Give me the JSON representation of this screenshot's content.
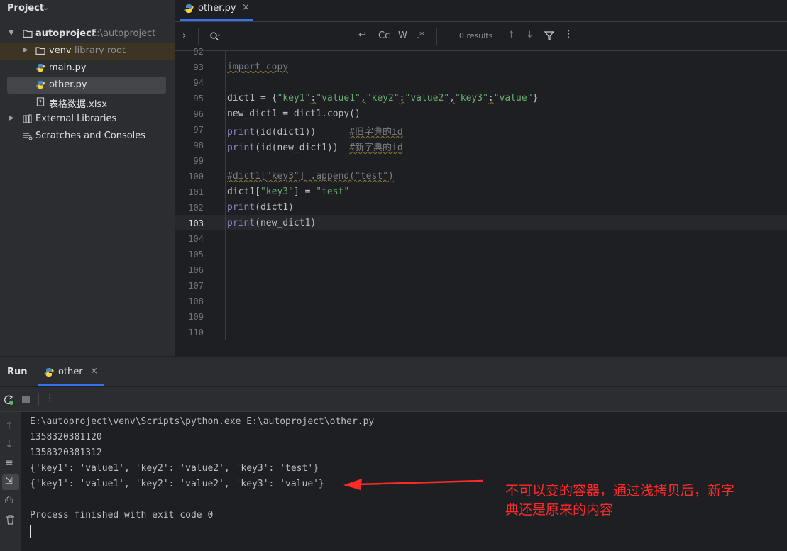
{
  "project_panel": {
    "title": "Project",
    "tree": [
      {
        "name": "autoproject",
        "hint": "E:\\autoproject"
      },
      {
        "name": "venv",
        "hint": "library root"
      },
      {
        "name": "main.py"
      },
      {
        "name": "other.py"
      },
      {
        "name": "表格数据.xlsx"
      },
      {
        "name": "External Libraries"
      },
      {
        "name": "Scratches and Consoles"
      }
    ]
  },
  "editor": {
    "tab_label": "other.py",
    "find": {
      "results": "0 results",
      "cc": "Cc",
      "w": "W",
      "regex": ".*"
    },
    "line_numbers": [
      "92",
      "93",
      "94",
      "95",
      "96",
      "97",
      "98",
      "99",
      "100",
      "101",
      "102",
      "103",
      "104",
      "105",
      "106",
      "107",
      "108",
      "109",
      "110"
    ],
    "code": {
      "l93": "import copy",
      "l95_a": "dict1 = {",
      "l95_k1": "\"key1\"",
      "l95_v1": "\"value1\"",
      "l95_k2": "\"key2\"",
      "l95_v2": "\"value2\"",
      "l95_k3": "\"key3\"",
      "l95_v3": "\"value\"",
      "l96": "new_dict1 = dict1.copy()",
      "l97_fn": "print",
      "l97_rest": "(id(dict1))",
      "l97_cmt": "#旧字典的id",
      "l98_fn": "print",
      "l98_rest": "(id(new_dict1))",
      "l98_cmt": "#新字典的id",
      "l100": "#dict1[\"key3\"] .append(\"test\")",
      "l101_a": "dict1[",
      "l101_s1": "\"key3\"",
      "l101_b": "] = ",
      "l101_s2": "\"test\"",
      "l102_fn": "print",
      "l102_rest": "(dict1)",
      "l103_fn": "print",
      "l103_rest": "(new_dict1)"
    }
  },
  "run_panel": {
    "title": "Run",
    "tab_label": "other",
    "output": [
      "E:\\autoproject\\venv\\Scripts\\python.exe E:\\autoproject\\other.py",
      "1358320381120",
      "1358320381312",
      "{'key1': 'value1', 'key2': 'value2', 'key3': 'test'}",
      "{'key1': 'value1', 'key2': 'value2', 'key3': 'value'}",
      "",
      "Process finished with exit code 0"
    ],
    "annotation": {
      "line1": "不可以变的容器，通过浅拷贝后，新字",
      "line2": "典还是原来的内容",
      "color": "#ff2a2a"
    }
  }
}
